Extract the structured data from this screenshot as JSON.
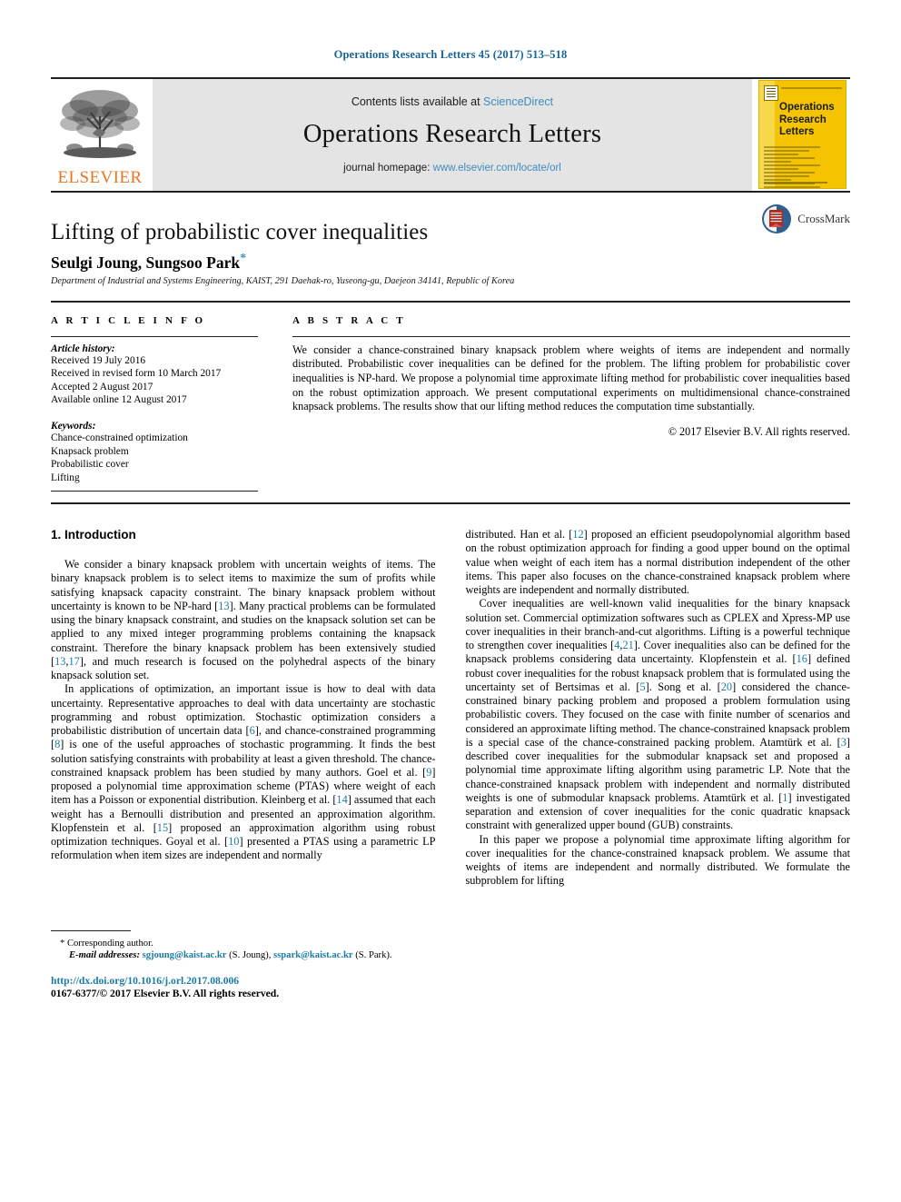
{
  "running_head": "Operations Research Letters 45 (2017) 513–518",
  "masthead": {
    "publisher_name": "ELSEVIER",
    "contents_prefix": "Contents lists available at ",
    "sciencedirect": "ScienceDirect",
    "journal_title": "Operations Research Letters",
    "homepage_prefix": "journal homepage: ",
    "homepage_url": "www.elsevier.com/locate/orl",
    "cover_title_line1": "Operations",
    "cover_title_line2": "Research",
    "cover_title_line3": "Letters"
  },
  "crossmark": {
    "label": "CrossMark"
  },
  "article": {
    "title": "Lifting of probabilistic cover inequalities",
    "authors": "Seulgi Joung, Sungsoo Park",
    "corresponding_marker": "*",
    "affiliation": "Department of Industrial and Systems Engineering, KAIST, 291 Daehak-ro, Yuseong-gu, Daejeon 34141, Republic of Korea"
  },
  "article_info": {
    "heading": "A R T I C L E   I N F O",
    "history_label": "Article history:",
    "history": [
      "Received 19 July 2016",
      "Received in revised form 10 March 2017",
      "Accepted 2 August 2017",
      "Available online 12 August 2017"
    ],
    "keywords_label": "Keywords:",
    "keywords": [
      "Chance-constrained optimization",
      "Knapsack problem",
      "Probabilistic cover",
      "Lifting"
    ]
  },
  "abstract": {
    "heading": "A B S T R A C T",
    "text": "We consider a chance-constrained binary knapsack problem where weights of items are independent and normally distributed. Probabilistic cover inequalities can be defined for the problem. The lifting problem for probabilistic cover inequalities is NP-hard. We propose a polynomial time approximate lifting method for probabilistic cover inequalities based on the robust optimization approach. We present computational experiments on multidimensional chance-constrained knapsack problems. The results show that our lifting method reduces the computation time substantially.",
    "copyright": "© 2017 Elsevier B.V. All rights reserved."
  },
  "body": {
    "section_number_title": "1. Introduction",
    "left_paragraphs": [
      "We consider a binary knapsack problem with uncertain weights of items. The binary knapsack problem is to select items to maximize the sum of profits while satisfying knapsack capacity constraint. The binary knapsack problem without uncertainty is known to be NP-hard [13]. Many practical problems can be formulated using the binary knapsack constraint, and studies on the knapsack solution set can be applied to any mixed integer programming problems containing the knapsack constraint. Therefore the binary knapsack problem has been extensively studied [13,17], and much research is focused on the polyhedral aspects of the binary knapsack solution set.",
      "In applications of optimization, an important issue is how to deal with data uncertainty. Representative approaches to deal with data uncertainty are stochastic programming and robust optimization. Stochastic optimization considers a probabilistic distribution of uncertain data [6], and chance-constrained programming [8] is one of the useful approaches of stochastic programming. It finds the best solution satisfying constraints with probability at least a given threshold. The chance-constrained knapsack problem has been studied by many authors. Goel et al. [9] proposed a polynomial time approximation scheme (PTAS) where weight of each item has a Poisson or exponential distribution. Kleinberg et al. [14] assumed that each weight has a Bernoulli distribution and presented an approximation algorithm. Klopfenstein et al. [15] proposed an approximation algorithm using robust optimization techniques. Goyal et al. [10] presented a PTAS using a parametric LP reformulation when item sizes are independent and normally"
    ],
    "right_paragraphs": [
      "distributed. Han et al. [12] proposed an efficient pseudopolynomial algorithm based on the robust optimization approach for finding a good upper bound on the optimal value when weight of each item has a normal distribution independent of the other items. This paper also focuses on the chance-constrained knapsack problem where weights are independent and normally distributed.",
      "Cover inequalities are well-known valid inequalities for the binary knapsack solution set. Commercial optimization softwares such as CPLEX and Xpress-MP use cover inequalities in their branch-and-cut algorithms. Lifting is a powerful technique to strengthen cover inequalities [4,21]. Cover inequalities also can be defined for the knapsack problems considering data uncertainty. Klopfenstein et al. [16] defined robust cover inequalities for the robust knapsack problem that is formulated using the uncertainty set of Bertsimas et al. [5]. Song et al. [20] considered the chance-constrained binary packing problem and proposed a problem formulation using probabilistic covers. They focused on the case with finite number of scenarios and considered an approximate lifting method. The chance-constrained knapsack problem is a special case of the chance-constrained packing problem. Atamtürk et al. [3] described cover inequalities for the submodular knapsack set and proposed a polynomial time approximate lifting algorithm using parametric LP. Note that the chance-constrained knapsack problem with independent and normally distributed weights is one of submodular knapsack problems. Atamtürk et al. [1] investigated separation and extension of cover inequalities for the conic quadratic knapsack constraint with generalized upper bound (GUB) constraints.",
      "In this paper we propose a polynomial time approximate lifting algorithm for cover inequalities for the chance-constrained knapsack problem. We assume that weights of items are independent and normally distributed. We formulate the subproblem for lifting"
    ]
  },
  "footnote": {
    "corresponding": "* Corresponding author.",
    "email_label": "E-mail addresses:",
    "email1": "sgjoung@kaist.ac.kr",
    "email1_owner": "(S. Joung),",
    "email2": "sspark@kaist.ac.kr",
    "email2_owner": "(S. Park).",
    "doi": "http://dx.doi.org/10.1016/j.orl.2017.08.006",
    "issn_line": "0167-6377/© 2017 Elsevier B.V. All rights reserved."
  },
  "colors": {
    "link": "#1a7ba8",
    "header_blue": "#1a6496",
    "elsevier_orange": "#e87722",
    "cover_yellow": "#f4c400",
    "banner_gray": "#e4e4e4"
  }
}
